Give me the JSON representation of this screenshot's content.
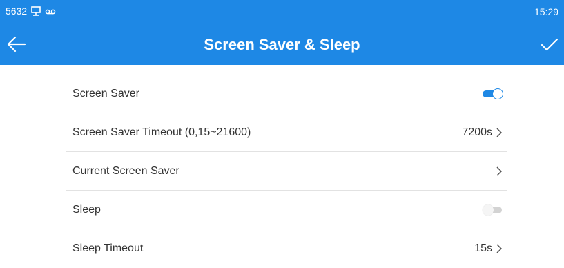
{
  "status_bar": {
    "left_text": "5632",
    "time": "15:29"
  },
  "header": {
    "title": "Screen Saver & Sleep",
    "back_icon": "arrow-left-icon",
    "confirm_icon": "checkmark-icon"
  },
  "colors": {
    "accent": "#1e88e5",
    "divider": "#e2e2e2",
    "text": "#333333",
    "toggle_off": "#d3d3d3"
  },
  "settings": [
    {
      "label": "Screen Saver",
      "control": "toggle",
      "on": true
    },
    {
      "label": "Screen Saver Timeout (0,15~21600)",
      "value": "7200s",
      "control": "chevron"
    },
    {
      "label": "Current Screen Saver",
      "value": "",
      "control": "chevron"
    },
    {
      "label": "Sleep",
      "control": "toggle",
      "on": false
    },
    {
      "label": "Sleep Timeout",
      "value": "15s",
      "control": "chevron"
    }
  ]
}
